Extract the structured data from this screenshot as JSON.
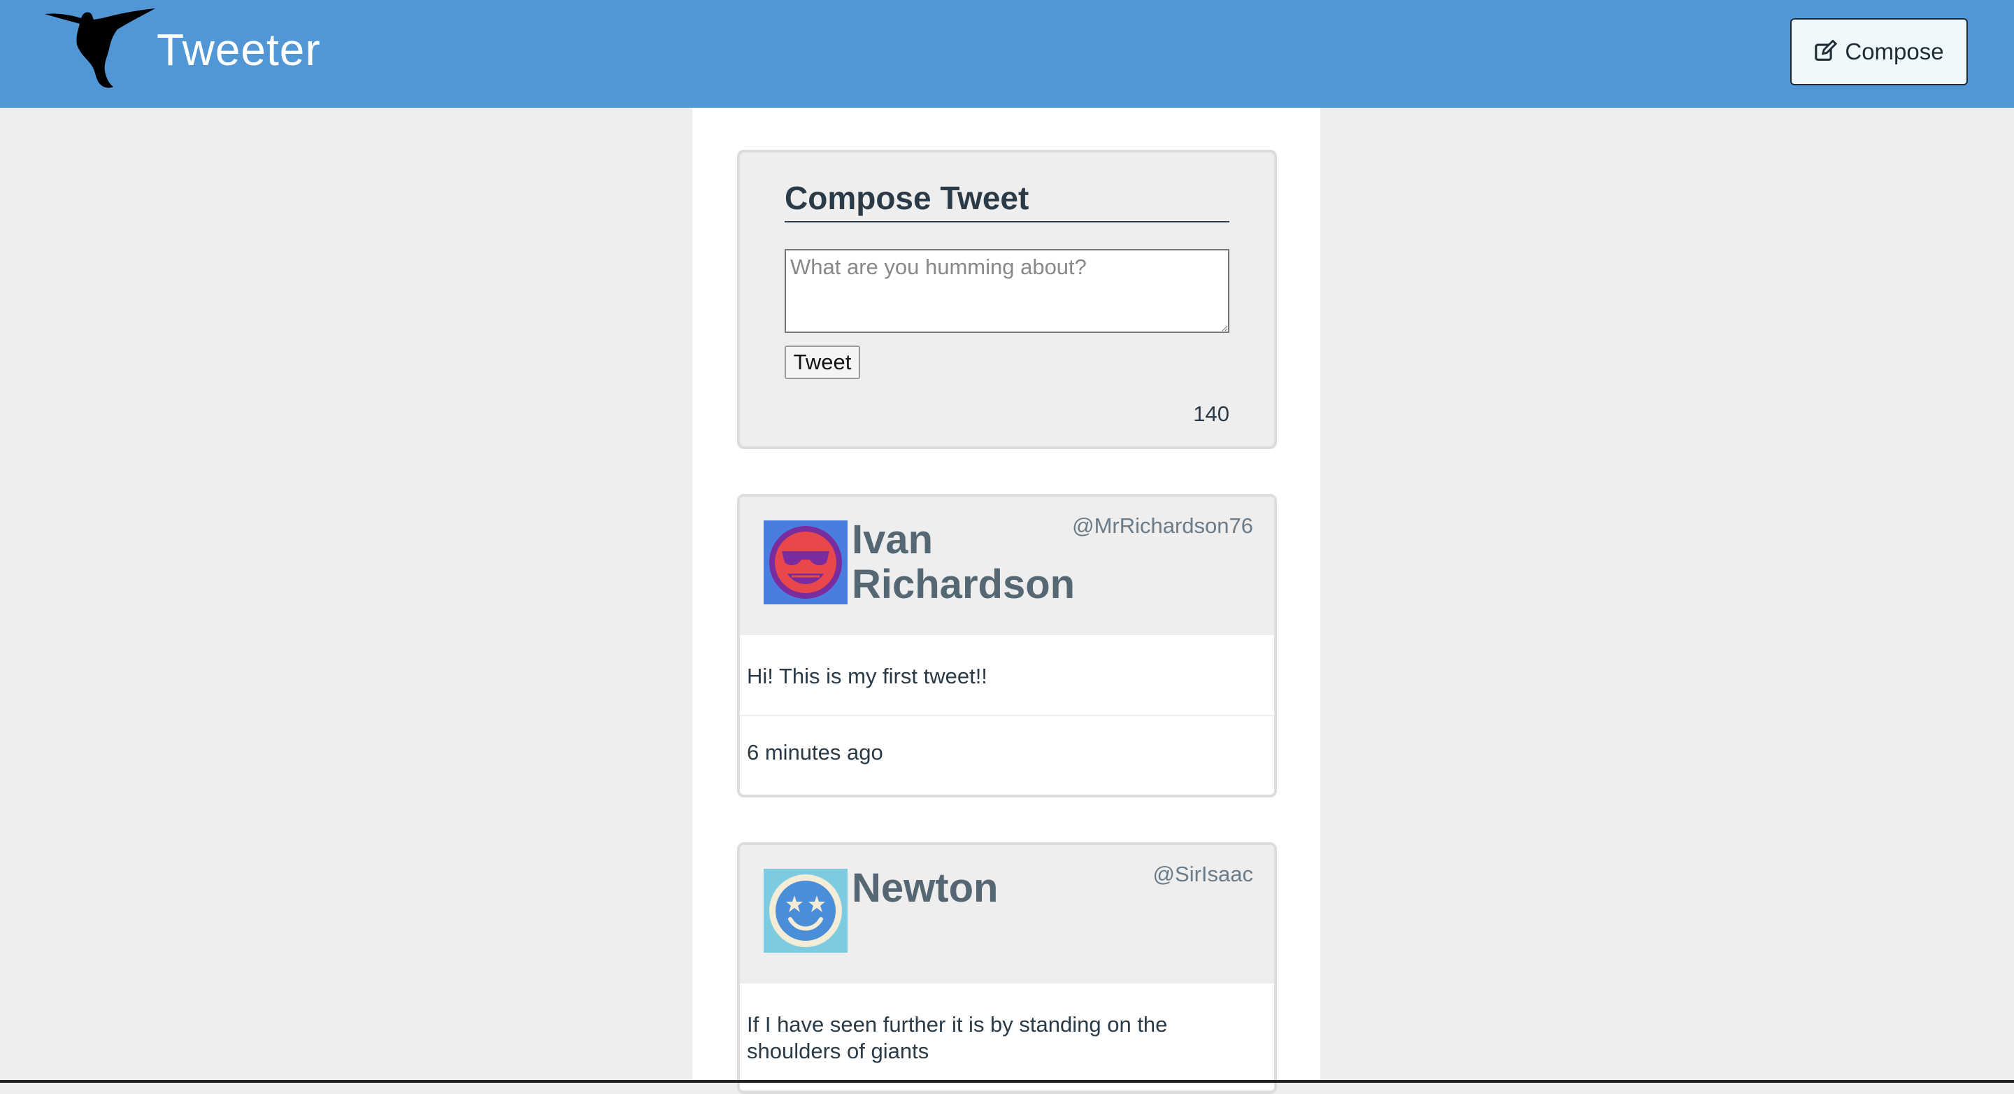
{
  "nav": {
    "brand": "Tweeter",
    "compose_label": "Compose",
    "logo_icon": "hummingbird-icon",
    "compose_icon": "edit-icon",
    "background_color": "#5197d6"
  },
  "compose": {
    "title": "Compose Tweet",
    "placeholder": "What are you humming about?",
    "value": "",
    "tweet_label": "Tweet",
    "counter": "140"
  },
  "tweets": [
    {
      "fullname": "Ivan Richardson",
      "handle": "@MrRichardson76",
      "text": "Hi! This is my first tweet!!",
      "time": "6 minutes ago",
      "avatar_icon": "sunglasses-smiley-avatar-icon",
      "avatar_color": "#4a7de0"
    },
    {
      "fullname": "Newton",
      "handle": "@SirIsaac",
      "text": "If I have seen further it is by standing on the shoulders of giants",
      "avatar_icon": "star-eyes-smiley-avatar-icon",
      "avatar_color": "#7ccbe0"
    }
  ]
}
